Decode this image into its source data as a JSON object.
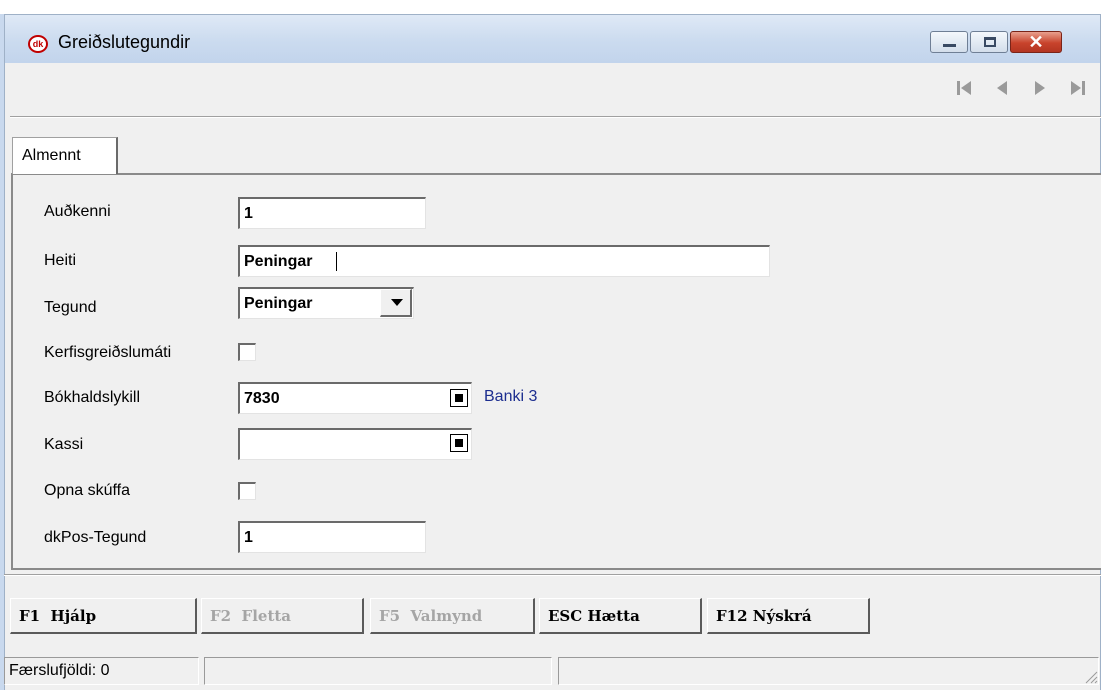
{
  "window": {
    "title": "Greiðslutegundir",
    "icon": "dk-app-icon",
    "controls": [
      "minimize",
      "maximize",
      "close"
    ]
  },
  "navigator": [
    "first-record-icon",
    "prior-record-icon",
    "next-record-icon",
    "last-record-icon"
  ],
  "tabs": [
    {
      "label": "Almennt",
      "active": true
    }
  ],
  "form": {
    "audkenni": {
      "label": "Auðkenni",
      "value": "1"
    },
    "heiti": {
      "label": "Heiti",
      "value": "Peningar"
    },
    "tegund": {
      "label": "Tegund",
      "value": "Peningar"
    },
    "kerfisgreidslumati": {
      "label": "Kerfisgreiðslumáti",
      "checked": false
    },
    "bokhaldslykill": {
      "label": "Bókhaldslykill",
      "value": "7830",
      "account_name": "Banki 3"
    },
    "kassi": {
      "label": "Kassi",
      "value": ""
    },
    "opna_skuffa": {
      "label": "Opna skúffa",
      "checked": false
    },
    "dkpos_tegund": {
      "label": "dkPos-Tegund",
      "value": "1"
    }
  },
  "buttons": {
    "help": {
      "key": "F1",
      "label": "Hjálp",
      "enabled": true
    },
    "browse": {
      "key": "F2",
      "label": "Fletta",
      "enabled": false
    },
    "menu": {
      "key": "F5",
      "label": "Valmynd",
      "enabled": false
    },
    "cancel": {
      "key": "ESC",
      "label": "Hætta",
      "enabled": true
    },
    "new_record": {
      "key": "F12",
      "label": "Nýskrá",
      "enabled": true
    }
  },
  "status": {
    "record_count_label": "Færslufjöldi:",
    "record_count": "0"
  },
  "colors": {
    "account_name": "#1c2d8f",
    "close_button": "#c8432c",
    "disabled_text": "#a5a5a5"
  }
}
